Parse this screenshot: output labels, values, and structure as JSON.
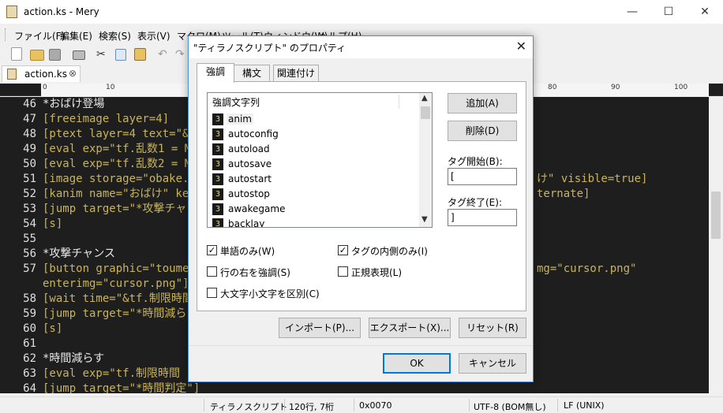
{
  "window": {
    "title": "action.ks - Mery",
    "minimize": "—",
    "maximize": "☐",
    "close": "✕"
  },
  "menu": [
    "ファイル(F)",
    "編集(E)",
    "検索(S)",
    "表示(V)",
    "マクロ(M)",
    "ツール(T)",
    "ウィンドウ(W)",
    "ヘルプ(H)"
  ],
  "tab": {
    "label": "action.ks",
    "close": "⊗"
  },
  "ruler": [
    "0",
    "10",
    "80",
    "90",
    "100"
  ],
  "editor_lines": [
    {
      "n": "46",
      "text": "*おばけ登場"
    },
    {
      "n": "47",
      "text": "[freeimage layer=4]"
    },
    {
      "n": "48",
      "text": "[ptext layer=4 text=\"&t"
    },
    {
      "n": "49",
      "text": "[eval exp=\"tf.乱数1 = M"
    },
    {
      "n": "50",
      "text": "[eval exp=\"tf.乱数2 = M"
    },
    {
      "n": "51",
      "text": "[image storage=\"obake.p",
      "tail": "け\" visible=true]"
    },
    {
      "n": "52",
      "text": "[kanim name=\"おばけ\" ke",
      "tail": "ternate]"
    },
    {
      "n": "53",
      "text": "[jump target=\"*攻撃チャ"
    },
    {
      "n": "54",
      "text": "[s]"
    },
    {
      "n": "55",
      "text": ""
    },
    {
      "n": "56",
      "text": "*攻撃チャンス"
    },
    {
      "n": "57",
      "text": "[button graphic=\"toumei",
      "tail": "mg=\"cursor.png\""
    },
    {
      "n": "",
      "text": "enterimg=\"cursor.png\"]"
    },
    {
      "n": "58",
      "text": "[wait time=\"&tf.制限時間"
    },
    {
      "n": "59",
      "text": "[jump target=\"*時間減ら"
    },
    {
      "n": "60",
      "text": "[s]"
    },
    {
      "n": "61",
      "text": ""
    },
    {
      "n": "62",
      "text": "*時間減らす"
    },
    {
      "n": "63",
      "text": "[eval exp=\"tf.制限時間"
    },
    {
      "n": "64",
      "text": "[jump target=\"*時間判定\"]"
    }
  ],
  "status": {
    "mode": "ティラノスクリプト",
    "position": "120行, 7桁",
    "code": "0x0070",
    "encoding": "UTF-8 (BOM無し)",
    "newline": "LF (UNIX)"
  },
  "dialog": {
    "title": "\"ティラノスクリプト\" のプロパティ",
    "close": "✕",
    "tabs": [
      "強調",
      "構文",
      "関連付け"
    ],
    "list_header": "強調文字列",
    "items": [
      {
        "level": "3",
        "word": "anim"
      },
      {
        "level": "3",
        "word": "autoconfig"
      },
      {
        "level": "3",
        "word": "autoload"
      },
      {
        "level": "3",
        "word": "autosave"
      },
      {
        "level": "3",
        "word": "autostart"
      },
      {
        "level": "3",
        "word": "autostop"
      },
      {
        "level": "3",
        "word": "awakegame"
      },
      {
        "level": "3",
        "word": "backlay"
      }
    ],
    "add_button": "追加(A)",
    "delete_button": "削除(D)",
    "tag_start_label": "タグ開始(B):",
    "tag_start_value": "[",
    "tag_end_label": "タグ終了(E):",
    "tag_end_value": "]",
    "checkboxes": [
      {
        "label": "単語のみ(W)",
        "checked": true
      },
      {
        "label": "タグの内側のみ(I)",
        "checked": true
      },
      {
        "label": "行の右を強調(S)",
        "checked": false
      },
      {
        "label": "正規表現(L)",
        "checked": false
      },
      {
        "label": "大文字小文字を区別(C)",
        "checked": false
      }
    ],
    "import_button": "インポート(P)...",
    "export_button": "エクスポート(X)...",
    "reset_button": "リセット(R)",
    "ok_button": "OK",
    "cancel_button": "キャンセル"
  }
}
